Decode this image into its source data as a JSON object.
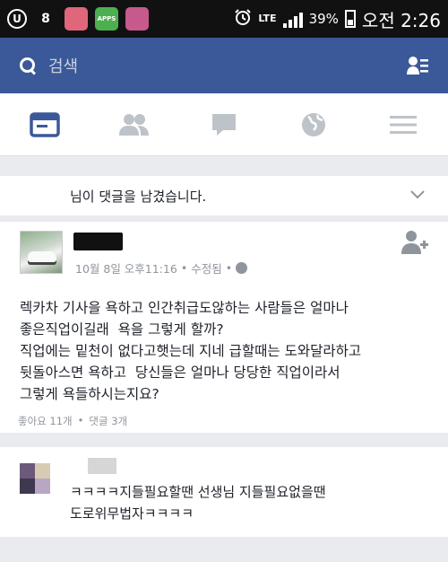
{
  "status_bar": {
    "app_icons": [
      {
        "name": "u-app-icon",
        "glyph": "U",
        "color": "#ffffff",
        "bg": "#111111"
      },
      {
        "name": "game-app-icon",
        "glyph": "8",
        "color": "#ffffff",
        "bg": "#111111"
      },
      {
        "name": "brain-app-icon",
        "glyph": "",
        "color": "#ffffff",
        "bg": "#e0667a"
      },
      {
        "name": "apps-app-icon",
        "glyph": "APPS",
        "color": "#ffffff",
        "bg": "#4caf50"
      },
      {
        "name": "media-app-icon",
        "glyph": "",
        "color": "#ffffff",
        "bg": "#c65a8c"
      }
    ],
    "network": "LTE",
    "battery": "39%",
    "time": "오전 2:26"
  },
  "header": {
    "search_placeholder": "검색"
  },
  "notice": {
    "text": "님이 댓글을 남겼습니다."
  },
  "post": {
    "date": "10월 8일 오후11:16",
    "edited": "수정됨",
    "separator": "•",
    "text": "렉카차 기사을 욕하고 인간취급도않하는 사람들은 얼마나\n좋은직업이길래  욕을 그렇게 할까?\n직업에는 밑천이 없다고햇는데 지네 급할때는 도와달라하고\n뒷돌아스면 욕하고  당신들은 얼마나 당당한 직업이라서\n그렇게 욕들하시는지요?",
    "likes": "좋아요 11개",
    "comments": "댓글 3개"
  },
  "comment": {
    "text": "ㅋㅋㅋㅋ지들필요할땐 선생님 지들필요없을땐\n도로위무법자ㅋㅋㅋㅋ"
  },
  "colors": {
    "brand": "#3b5998",
    "active_tab": "#3b5998",
    "inactive_tab": "#bec3c9"
  }
}
